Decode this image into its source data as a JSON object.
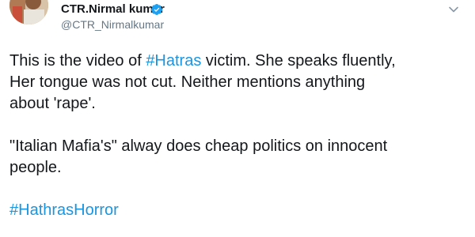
{
  "user": {
    "name": "CTR.Nirmal kumar",
    "handle": "@CTR_Nirmalkumar"
  },
  "tweet": {
    "line1_pre": "This is the video of ",
    "hashtag1": "#Hatras",
    "line1_post": " victim. She speaks fluently,",
    "line2": "Her tongue was not cut. Neither mentions anything",
    "line3": "about 'rape'.",
    "line4": "\"Italian Mafia's\" alway does cheap politics on innocent",
    "line5": "people.",
    "hashtag2": "#HathrasHorror"
  },
  "colors": {
    "link": "#1b95e0",
    "verified": "#1da1f2",
    "muted": "#657786"
  },
  "icons": {
    "verified": "verified-badge-icon",
    "menu": "chevron-down-icon"
  }
}
